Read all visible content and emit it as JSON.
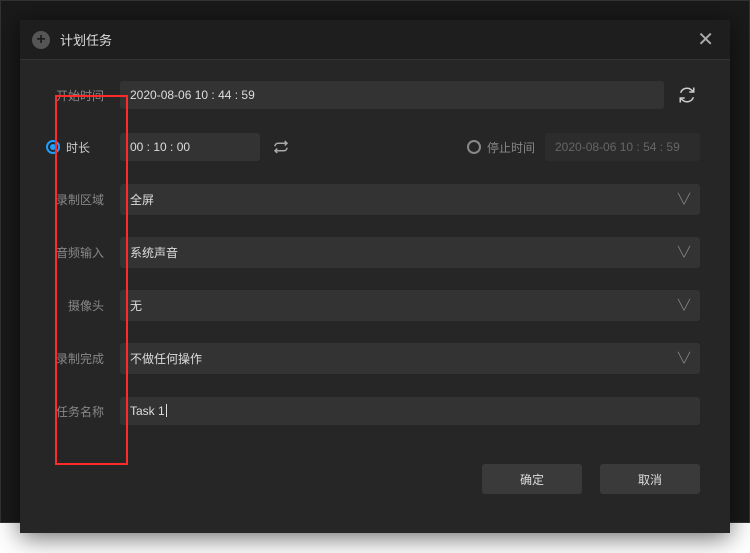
{
  "titlebar": {
    "title": "计划任务"
  },
  "labels": {
    "start_time": "开始时间",
    "duration": "时长",
    "stop_time": "停止时间",
    "record_area": "录制区域",
    "audio_input": "音频输入",
    "camera": "摄像头",
    "on_complete": "录制完成",
    "task_name": "任务名称"
  },
  "values": {
    "start_time": "2020-08-06 10 : 44 : 59",
    "duration": "00 : 10 : 00",
    "stop_time": "2020-08-06 10 : 54 : 59",
    "record_area": "全屏",
    "audio_input": "系统声音",
    "camera": "无",
    "on_complete": "不做任何操作",
    "task_name": "Task 1"
  },
  "buttons": {
    "ok": "确定",
    "cancel": "取消"
  }
}
